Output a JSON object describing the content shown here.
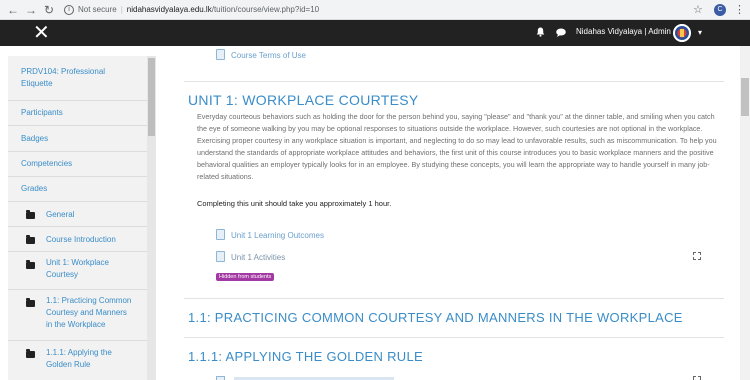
{
  "browser": {
    "security_label": "Not secure",
    "host": "nidahasvidyalaya.edu.lk",
    "path": "/tuition/course/view.php?id=10",
    "profile_letter": "C"
  },
  "navbar": {
    "username": "Nidahas Vidyalaya | Admin"
  },
  "drawer": {
    "items": [
      {
        "label": "PRDV104: Professional Etiquette"
      },
      {
        "label": "Participants"
      },
      {
        "label": "Badges"
      },
      {
        "label": "Competencies"
      },
      {
        "label": "Grades"
      },
      {
        "label": "General"
      },
      {
        "label": "Course Introduction"
      },
      {
        "label": "Unit 1: Workplace Courtesy"
      },
      {
        "label": "1.1: Practicing Common Courtesy and Manners in the Workplace"
      },
      {
        "label": "1.1.1: Applying the Golden Rule"
      }
    ]
  },
  "main": {
    "terms_link": "Course Terms of Use",
    "unit_title": "UNIT 1: WORKPLACE COURTESY",
    "summary": "Everyday courteous behaviors such as holding the door for the person behind you, saying \"please\" and \"thank you\" at the dinner table, and smiling when you catch the eye of someone walking by you may be optional responses to situations outside the workplace. However, such courtesies are not optional in the workplace. Exercising proper courtesy in any workplace situation is important, and neglecting to do so may lead to unfavorable results, such as miscommunication. To help you understand the standards of appropriate workplace attitudes and behaviors, the first unit of this course introduces you to basic workplace manners and the positive behavioral qualities an employer typically looks for in an employee. By studying these concepts, you will learn the appropriate way to handle yourself in many job-related situations.",
    "completion_note": "Completing this unit should take you approximately 1 hour.",
    "outcomes_link": "Unit 1 Learning Outcomes",
    "activities_link": "Unit 1 Activities",
    "hidden_badge": "Hidden from students",
    "section_11": "1.1: PRACTICING COMMON COURTESY AND MANNERS IN THE WORKPLACE",
    "section_111": "1.1.1: APPLYING THE GOLDEN RULE"
  },
  "colors": {
    "navbar": "#222222",
    "link": "#3a8dc8",
    "badge": "#a33aa3",
    "drawer": "#f2f2f2"
  }
}
